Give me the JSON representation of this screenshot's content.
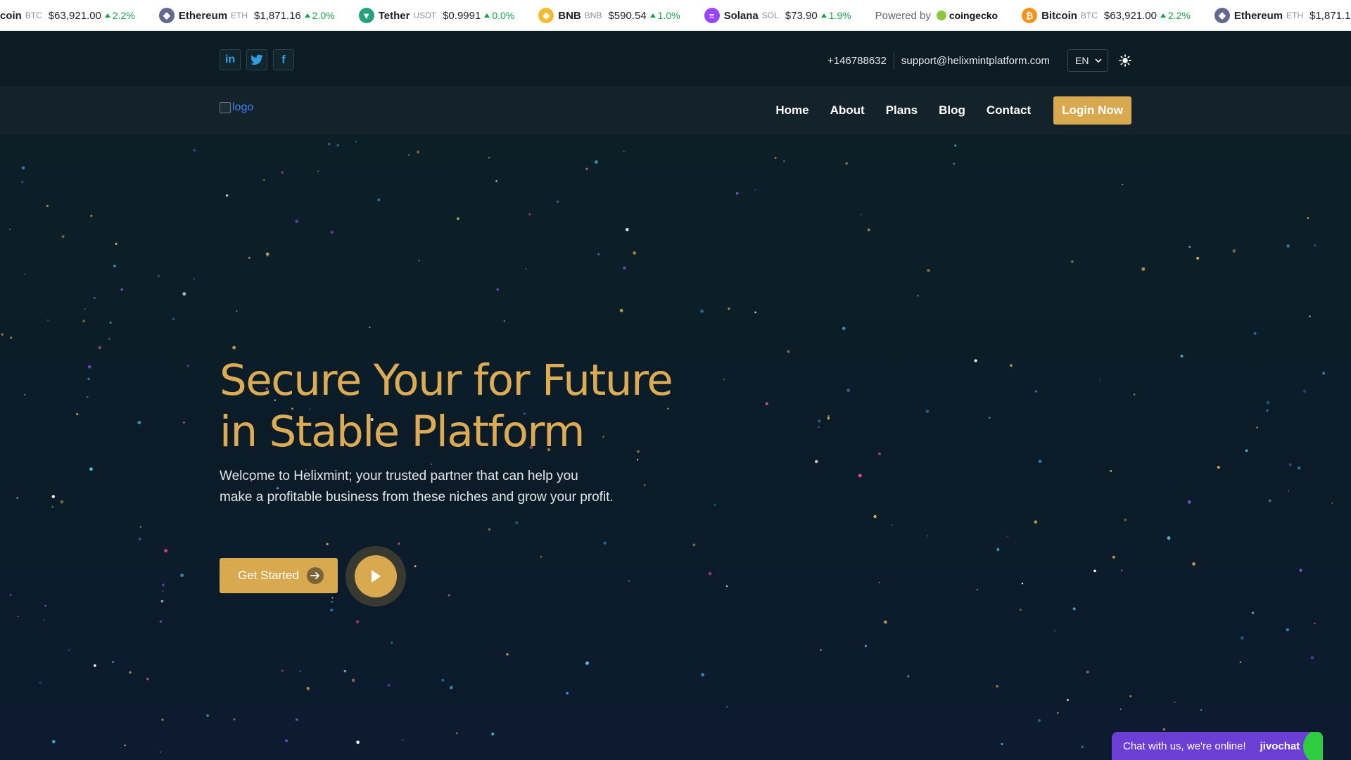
{
  "ticker": {
    "coins": [
      {
        "name": "coin",
        "sym": "BTC",
        "price": "$63,921.00",
        "change": "2.2%",
        "color": "#f7931a",
        "icon": "bitcoin-icon",
        "partial": true
      },
      {
        "name": "Ethereum",
        "sym": "ETH",
        "price": "$1,871.16",
        "change": "2.0%",
        "color": "#62688f",
        "icon": "ethereum-icon"
      },
      {
        "name": "Tether",
        "sym": "USDT",
        "price": "$0.9991",
        "change": "0.0%",
        "color": "#26a17b",
        "icon": "tether-icon"
      },
      {
        "name": "BNB",
        "sym": "BNB",
        "price": "$590.54",
        "change": "1.0%",
        "color": "#f3ba2f",
        "icon": "bnb-icon"
      },
      {
        "name": "Solana",
        "sym": "SOL",
        "price": "$73.90",
        "change": "1.9%",
        "color": "#9945ff",
        "icon": "solana-icon"
      }
    ],
    "powered_label": "Powered by",
    "powered_brand": "coingecko",
    "coins_repeat": [
      {
        "name": "Bitcoin",
        "sym": "BTC",
        "price": "$63,921.00",
        "change": "2.2%",
        "color": "#f7931a",
        "icon": "bitcoin-icon"
      },
      {
        "name": "Ethereum",
        "sym": "ETH",
        "price": "$1,871.16",
        "change": "2.0%",
        "color": "#62688f",
        "icon": "ethereum-icon"
      }
    ]
  },
  "topbar": {
    "socials": [
      {
        "name": "linkedin-icon",
        "glyph": "in"
      },
      {
        "name": "twitter-icon",
        "glyph": ""
      },
      {
        "name": "facebook-icon",
        "glyph": "f"
      }
    ],
    "phone": "+146788632",
    "email": "support@helixmintplatform.com",
    "language": "EN"
  },
  "navbar": {
    "logo_alt": "logo",
    "links": [
      "Home",
      "About",
      "Plans",
      "Blog",
      "Contact"
    ],
    "login_label": "Login Now"
  },
  "hero": {
    "title_line1": "Secure Your for Future",
    "title_line2": "in Stable Platform",
    "description": "Welcome to Helixmint; your trusted partner that can help you make a profitable business from these niches and grow your profit.",
    "cta_label": "Get Started"
  },
  "chat": {
    "text": "Chat with us, we're online!",
    "brand": "jivochat"
  },
  "colors": {
    "accent": "#d8a94f",
    "title_gold": "#dcab53",
    "positive": "#16a34a",
    "chat_purple": "#6b3fd3"
  }
}
